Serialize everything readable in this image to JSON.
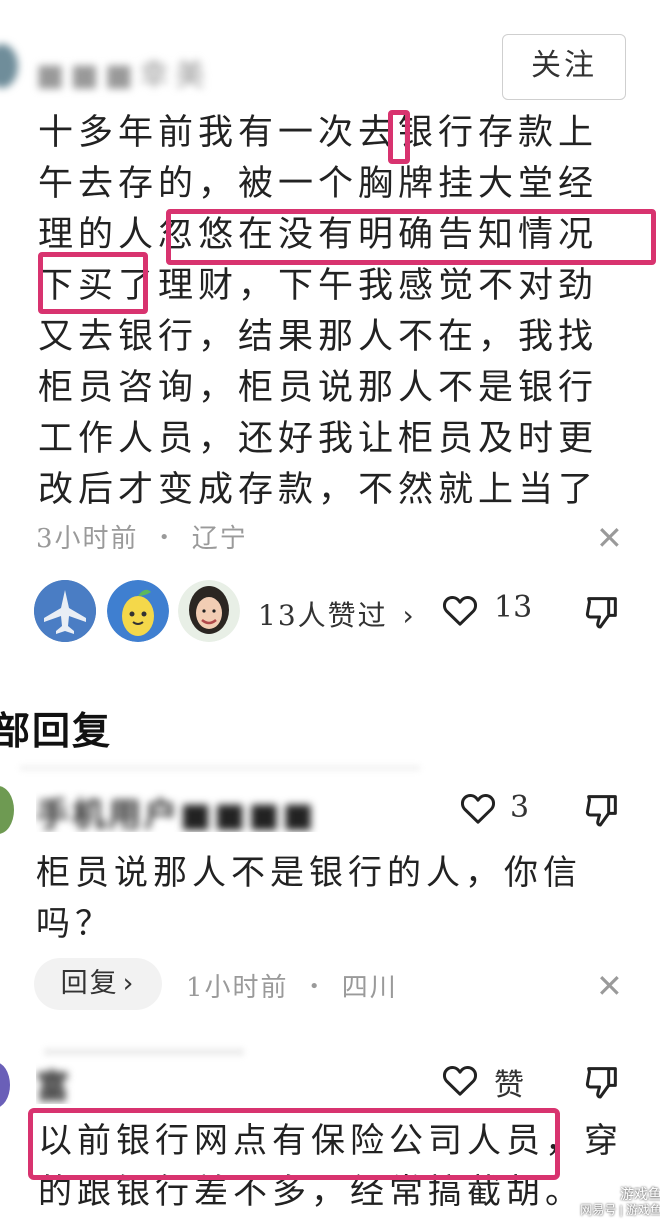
{
  "comment": {
    "username": "■■■幸美",
    "follow_label": "关注",
    "text": "十多年前我有一次去银行存款上午去存的，被一个胸牌挂大堂经理的人忽悠在没有明确告知情况下买了理财，下午我感觉不对劲又去银行，结果那人不在，我找柜员咨询，柜员说那人不是银行工作人员，还好我让柜员及时更改后才变成存款，不然就上当了",
    "time": "3小时前",
    "dot": "•",
    "location": "辽宁",
    "close": "✕",
    "liked_by": "13人赞过",
    "liked_by_arrow": "›",
    "like_count": "13"
  },
  "replies_header": "部回复",
  "replies": [
    {
      "username": "手机用户■■■■",
      "like_count": "3",
      "text": "柜员说那人不是银行的人，你信吗？",
      "reply_label": "回复",
      "reply_arrow": "›",
      "time": "1小时前",
      "dot": "•",
      "location": "四川",
      "close": "✕"
    },
    {
      "username": "富■■■■■",
      "like_label": "赞",
      "text": "以前银行网点有保险公司人员，穿的跟银行差不多，经常搞截胡。"
    }
  ],
  "watermark": {
    "line1": "游戏鱼",
    "line2": "网易号 | 游戏鱼"
  },
  "colors": {
    "highlight": "#d8336f",
    "meta_gray": "#9a9a9a",
    "pill_bg": "#f2f2f2"
  }
}
